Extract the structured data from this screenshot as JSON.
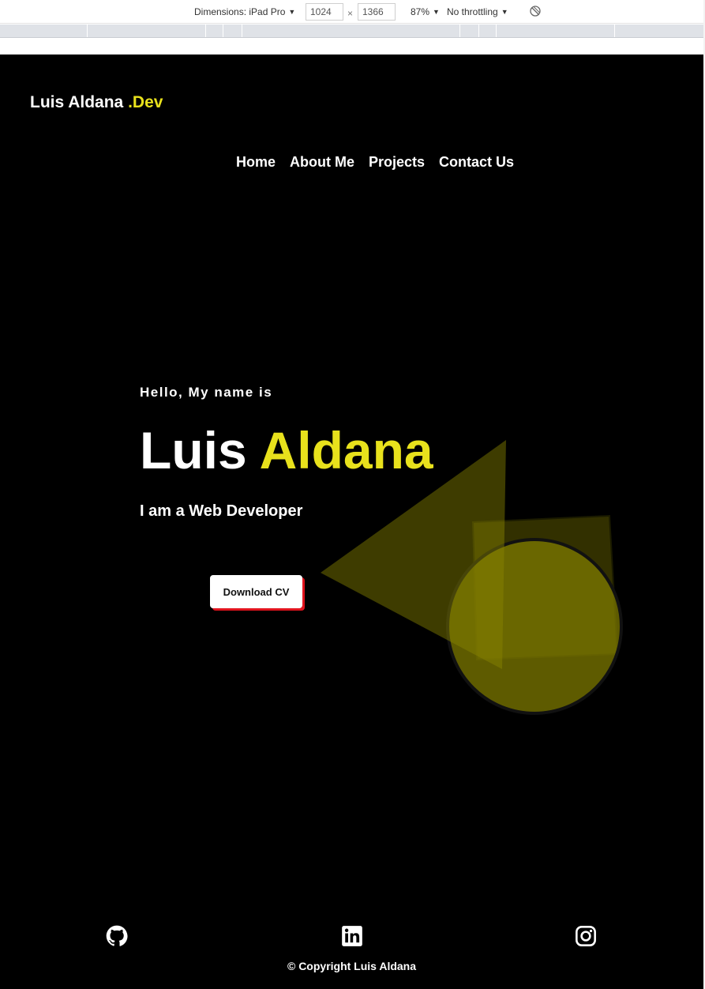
{
  "devtools": {
    "dimensions_label": "Dimensions: iPad Pro",
    "width_value": "1024",
    "times_sign": "×",
    "height_value": "1366",
    "zoom": "87%",
    "throttling": "No throttling"
  },
  "header": {
    "logo_name": "Luis Aldana ",
    "logo_accent": ".Dev"
  },
  "nav": {
    "items": [
      "Home",
      "About Me",
      "Projects",
      "Contact Us"
    ]
  },
  "hero": {
    "greeting": "Hello, My name is",
    "first_name": "Luis ",
    "last_name": "Aldana",
    "role": "I am a Web Developer",
    "cv_button": "Download CV"
  },
  "footer": {
    "icons": [
      "github-icon",
      "linkedin-icon",
      "instagram-icon"
    ],
    "copyright": "© Copyright Luis Aldana"
  },
  "colors": {
    "background": "#000000",
    "accent": "#e8e11c",
    "button_shadow": "#e0141e"
  }
}
